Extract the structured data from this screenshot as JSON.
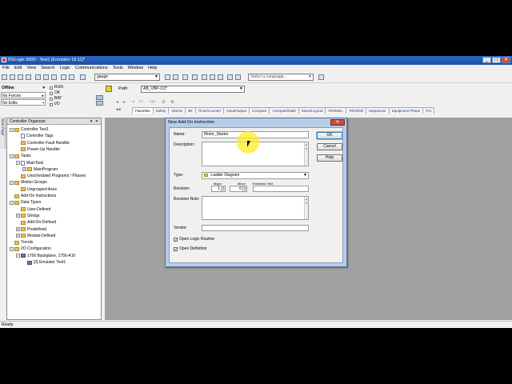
{
  "window": {
    "title": "RSLogix 5000 - Test1 [Emulator 19.11]*",
    "minimize": "_",
    "maximize": "□",
    "close": "✕"
  },
  "menu": [
    "File",
    "Edit",
    "View",
    "Search",
    "Logic",
    "Communications",
    "Tools",
    "Window",
    "Help"
  ],
  "toolbar": {
    "search_value": "gauge",
    "language_placeholder": "Select a Language..."
  },
  "status": {
    "mode": "Offline",
    "forces": "No Forces",
    "edits": "No Edits",
    "indicators": [
      "RUN",
      "OK",
      "BAT",
      "I/O"
    ]
  },
  "path": {
    "label": "Path:",
    "value": "AB_VBP-1\\3*"
  },
  "instruction_tabs": [
    "Favorites",
    "Safety",
    "Alarms",
    "Bit",
    "Timer/Counter",
    "Input/Output",
    "Compare",
    "Compute/Math",
    "Move/Logical",
    "File/Misc.",
    "File/Shift",
    "Sequencer",
    "Equipment Phase",
    "Pro"
  ],
  "side_tab": "Start Page",
  "organizer": {
    "title": "Controller Organizer",
    "controls": "▾ ✕",
    "tree": [
      {
        "label": "Controller Test1",
        "level": 0,
        "exp": "−",
        "icon": "folder"
      },
      {
        "label": "Controller Tags",
        "level": 1,
        "exp": "",
        "icon": "doc"
      },
      {
        "label": "Controller Fault Handler",
        "level": 1,
        "exp": "",
        "icon": "folder"
      },
      {
        "label": "Power-Up Handler",
        "level": 1,
        "exp": "",
        "icon": "folder"
      },
      {
        "label": "Tasks",
        "level": 0,
        "exp": "−",
        "icon": "folder"
      },
      {
        "label": "MainTask",
        "level": 1,
        "exp": "−",
        "icon": "doc"
      },
      {
        "label": "MainProgram",
        "level": 2,
        "exp": "+",
        "icon": "folder"
      },
      {
        "label": "Unscheduled Programs / Phases",
        "level": 1,
        "exp": "",
        "icon": "folder"
      },
      {
        "label": "Motion Groups",
        "level": 0,
        "exp": "−",
        "icon": "folder"
      },
      {
        "label": "Ungrouped Axes",
        "level": 1,
        "exp": "",
        "icon": "folder"
      },
      {
        "label": "Add-On Instructions",
        "level": 0,
        "exp": "",
        "icon": "folder"
      },
      {
        "label": "Data Types",
        "level": 0,
        "exp": "−",
        "icon": "folder"
      },
      {
        "label": "User-Defined",
        "level": 1,
        "exp": "",
        "icon": "folder"
      },
      {
        "label": "Strings",
        "level": 1,
        "exp": "+",
        "icon": "folder"
      },
      {
        "label": "Add-On-Defined",
        "level": 1,
        "exp": "",
        "icon": "folder"
      },
      {
        "label": "Predefined",
        "level": 1,
        "exp": "+",
        "icon": "folder"
      },
      {
        "label": "Module-Defined",
        "level": 1,
        "exp": "+",
        "icon": "folder"
      },
      {
        "label": "Trends",
        "level": 0,
        "exp": "",
        "icon": "folder"
      },
      {
        "label": "I/O Configuration",
        "level": 0,
        "exp": "−",
        "icon": "folder"
      },
      {
        "label": "1756 Backplane, 1756-A10",
        "level": 1,
        "exp": "−",
        "icon": "chip"
      },
      {
        "label": "[3] Emulator Test1",
        "level": 2,
        "exp": "",
        "icon": "chip"
      }
    ]
  },
  "statusbar": "Ready",
  "dialog": {
    "title": "New Add-On Instruction",
    "close": "✕",
    "name_label": "Name:",
    "name_value": "Motor_Starter",
    "description_label": "Description:",
    "type_label": "Type:",
    "type_value": "Ladder Diagram",
    "revision_label": "Revision:",
    "major_label": "Major",
    "minor_label": "Minor",
    "extended_label": "Extended Text",
    "major_value": "1",
    "minor_value": "0",
    "revision_note_label": "Revision Note:",
    "vendor_label": "Vendor:",
    "open_logic_label": "Open Logic Routine",
    "open_definition_label": "Open Definition",
    "ok": "OK",
    "cancel": "Cancel",
    "help": "Help",
    "check": "✓"
  }
}
